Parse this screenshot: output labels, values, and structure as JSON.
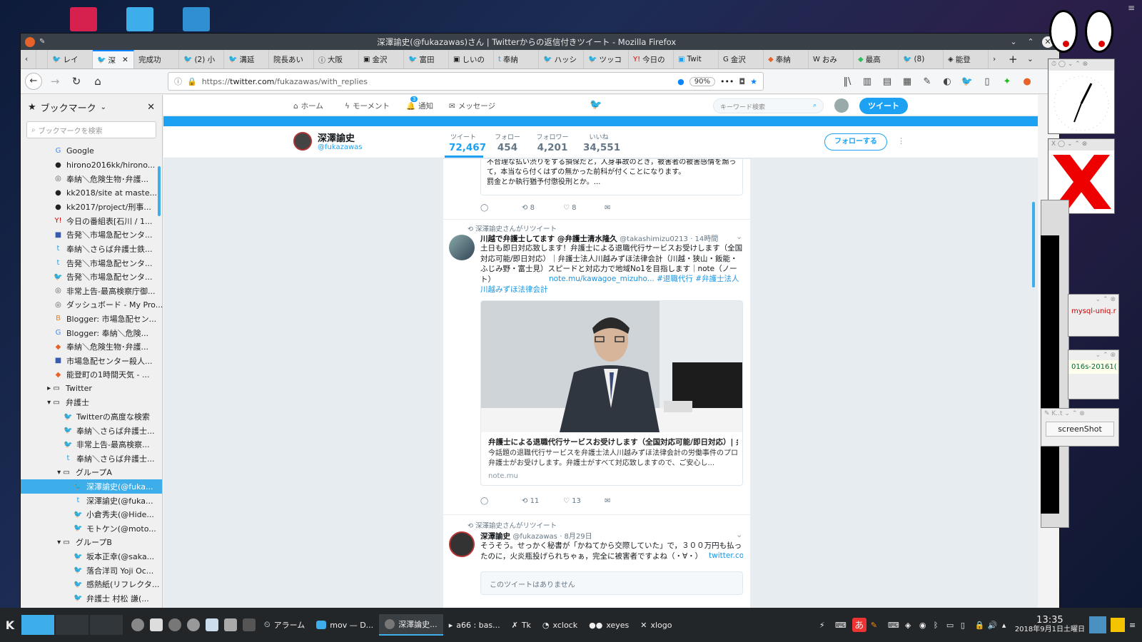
{
  "browser": {
    "title": "深澤諭史(@fukazawas)さん | Twitterからの返信付きツイート - Mozilla Firefox",
    "url_prefix": "https://",
    "url_host": "twitter.com",
    "url_path": "/fukazawas/with_replies",
    "zoom": "90%",
    "tabs": [
      "レイ",
      "深",
      "完成功",
      "(2) 小",
      "溝延",
      "院長あい",
      "大阪",
      "金沢",
      "富田",
      "しいの",
      "奉納",
      "ハッシ",
      "ツッコ",
      "今日の",
      "Twit",
      "金沢",
      "奉納",
      "おみ",
      "最高",
      "(8)",
      "能登"
    ]
  },
  "sidebar": {
    "title": "ブックマーク",
    "search_placeholder": "ブックマークを検索",
    "items": [
      {
        "label": "Google",
        "icon": "G",
        "indent": 46
      },
      {
        "label": "hirono2016kk/hirono...",
        "icon": "●",
        "indent": 46
      },
      {
        "label": "奉納＼危険生物･弁護...",
        "icon": "◎",
        "indent": 46
      },
      {
        "label": "kk2018/site at maste...",
        "icon": "●",
        "indent": 46
      },
      {
        "label": "kk2017/project/刑事...",
        "icon": "●",
        "indent": 46
      },
      {
        "label": "今日の番組表[石川 / 1...",
        "icon": "Y!",
        "indent": 46
      },
      {
        "label": "告発＼市場急配センタ...",
        "icon": "■",
        "indent": 46
      },
      {
        "label": "奉納＼さらば弁護士鉄...",
        "icon": "t",
        "indent": 46
      },
      {
        "label": "告発＼市場急配センタ...",
        "icon": "t",
        "indent": 46
      },
      {
        "label": "告発＼市場急配センタ...",
        "icon": "🐦",
        "indent": 46
      },
      {
        "label": "非常上告-最高検察庁御...",
        "icon": "◎",
        "indent": 46
      },
      {
        "label": "ダッシュボード - My Pro...",
        "icon": "◎",
        "indent": 46
      },
      {
        "label": "Blogger: 市場急配セン...",
        "icon": "B",
        "indent": 46
      },
      {
        "label": "Blogger: 奉納＼危険...",
        "icon": "G",
        "indent": 46
      },
      {
        "label": "奉納＼危険生物･弁護...",
        "icon": "◆",
        "indent": 46
      },
      {
        "label": "市場急配センター殺人...",
        "icon": "■",
        "indent": 46
      },
      {
        "label": "能登町の1時間天気 - ...",
        "icon": "◆",
        "indent": 46
      },
      {
        "label": "Twitter",
        "icon": "▸ ▭",
        "indent": 34
      },
      {
        "label": "弁護士",
        "icon": "▾ ▭",
        "indent": 34
      },
      {
        "label": "Twitterの高度な検索",
        "icon": "🐦",
        "indent": 60
      },
      {
        "label": "奉納＼さらば弁護士...",
        "icon": "🐦",
        "indent": 60
      },
      {
        "label": "非常上告-最高検察...",
        "icon": "🐦",
        "indent": 60
      },
      {
        "label": "奉納＼さらば弁護士...",
        "icon": "t",
        "indent": 60
      },
      {
        "label": "グループA",
        "icon": "▾ ▭",
        "indent": 48
      },
      {
        "label": "深澤諭史(@fuka...",
        "icon": "🐦",
        "indent": 74,
        "selected": true
      },
      {
        "label": "深澤諭史(@fuka...",
        "icon": "t",
        "indent": 74
      },
      {
        "label": "小倉秀夫(@Hide...",
        "icon": "🐦",
        "indent": 74
      },
      {
        "label": "モトケン(@moto...",
        "icon": "🐦",
        "indent": 74
      },
      {
        "label": "グループB",
        "icon": "▾ ▭",
        "indent": 48
      },
      {
        "label": "坂本正幸(@saka...",
        "icon": "🐦",
        "indent": 74
      },
      {
        "label": "落合洋司 Yoji Oc...",
        "icon": "🐦",
        "indent": 74
      },
      {
        "label": "感熱紙(リフレクタ...",
        "icon": "🐦",
        "indent": 74
      },
      {
        "label": "弁護士 村松 謙(...",
        "icon": "🐦",
        "indent": 74
      }
    ]
  },
  "twitter": {
    "nav": {
      "home": "ホーム",
      "moments": "モーメント",
      "notifications": "通知",
      "notif_count": "3",
      "messages": "メッセージ"
    },
    "search_placeholder": "キーワード検索",
    "tweet_button": "ツイート",
    "profile": {
      "name": "深澤諭史",
      "handle": "@fukazawas",
      "follow": "フォローする"
    },
    "stats": [
      {
        "label": "ツイート",
        "value": "72,467"
      },
      {
        "label": "フォロー",
        "value": "454"
      },
      {
        "label": "フォロワー",
        "value": "4,201"
      },
      {
        "label": "いいね",
        "value": "34,551"
      }
    ],
    "tweet0": {
      "text": "不合理な払い渋りをする損保だと，人身事故のとき，被害者の被害感情を煽って，本当なら付くはずの無かった前科が付くことになります。\n罰金とか執行猶予付懲役刑とか。...",
      "retweets": "8",
      "likes": "8"
    },
    "tweet1": {
      "rt_by": "深澤諭史さんがリツイート",
      "name": "川越で弁護士してます @弁護士清水隆久",
      "handle": "@takashimizu0213",
      "time": "· 14時間",
      "text": "土日も即日対応致します！弁護士による退職代行サービスお受けします（全国対応可能/即日対応）｜弁護士法人川越みずほ法律会計（川越・狭山・飯能・ふじみ野・富士見）スピードと対応力で地域No1を目指します｜note（ノート）",
      "links": "note.mu/kawagoe_mizuho... #退職代行 #弁護士法人川越みずほ法律会計",
      "card_title": "弁護士による退職代行サービスお受けします（全国対応可能/即日対応）| 弁...",
      "card_desc": "今話題の退職代行サービスを弁護士法人川越みずほ法律会計の労働事件のプロ弁護士がお受けします。弁護士がすべて対応致しますので、ご安心し...",
      "card_domain": "note.mu",
      "retweets": "11",
      "likes": "13"
    },
    "tweet2": {
      "rt_by": "深澤諭史さんがリツイート",
      "name": "深澤諭史",
      "handle": "@fukazawas",
      "time": "· 8月29日",
      "text": "そうそう。せっかく秘書が「かねてから交際していた」で，３００万円も払ったのに，火炎瓶投げられちゃぁ，完全に被害者ですよね（・∀・）",
      "link": "twitter.com/redcrab_librar...",
      "unavailable": "このツイートはありません"
    }
  },
  "right_panel": {
    "screenshot_label": "screenShot",
    "text1": "mysql-uniq.r",
    "text2": "016s-20161("
  },
  "taskbar": {
    "items": [
      "アラーム",
      "mov — D...",
      "深澤論史...",
      "a66 : bas...",
      "Tk",
      "xclock",
      "xeyes",
      "xlogo"
    ],
    "time": "13:35",
    "date": "2018年9月1日土曜日"
  }
}
